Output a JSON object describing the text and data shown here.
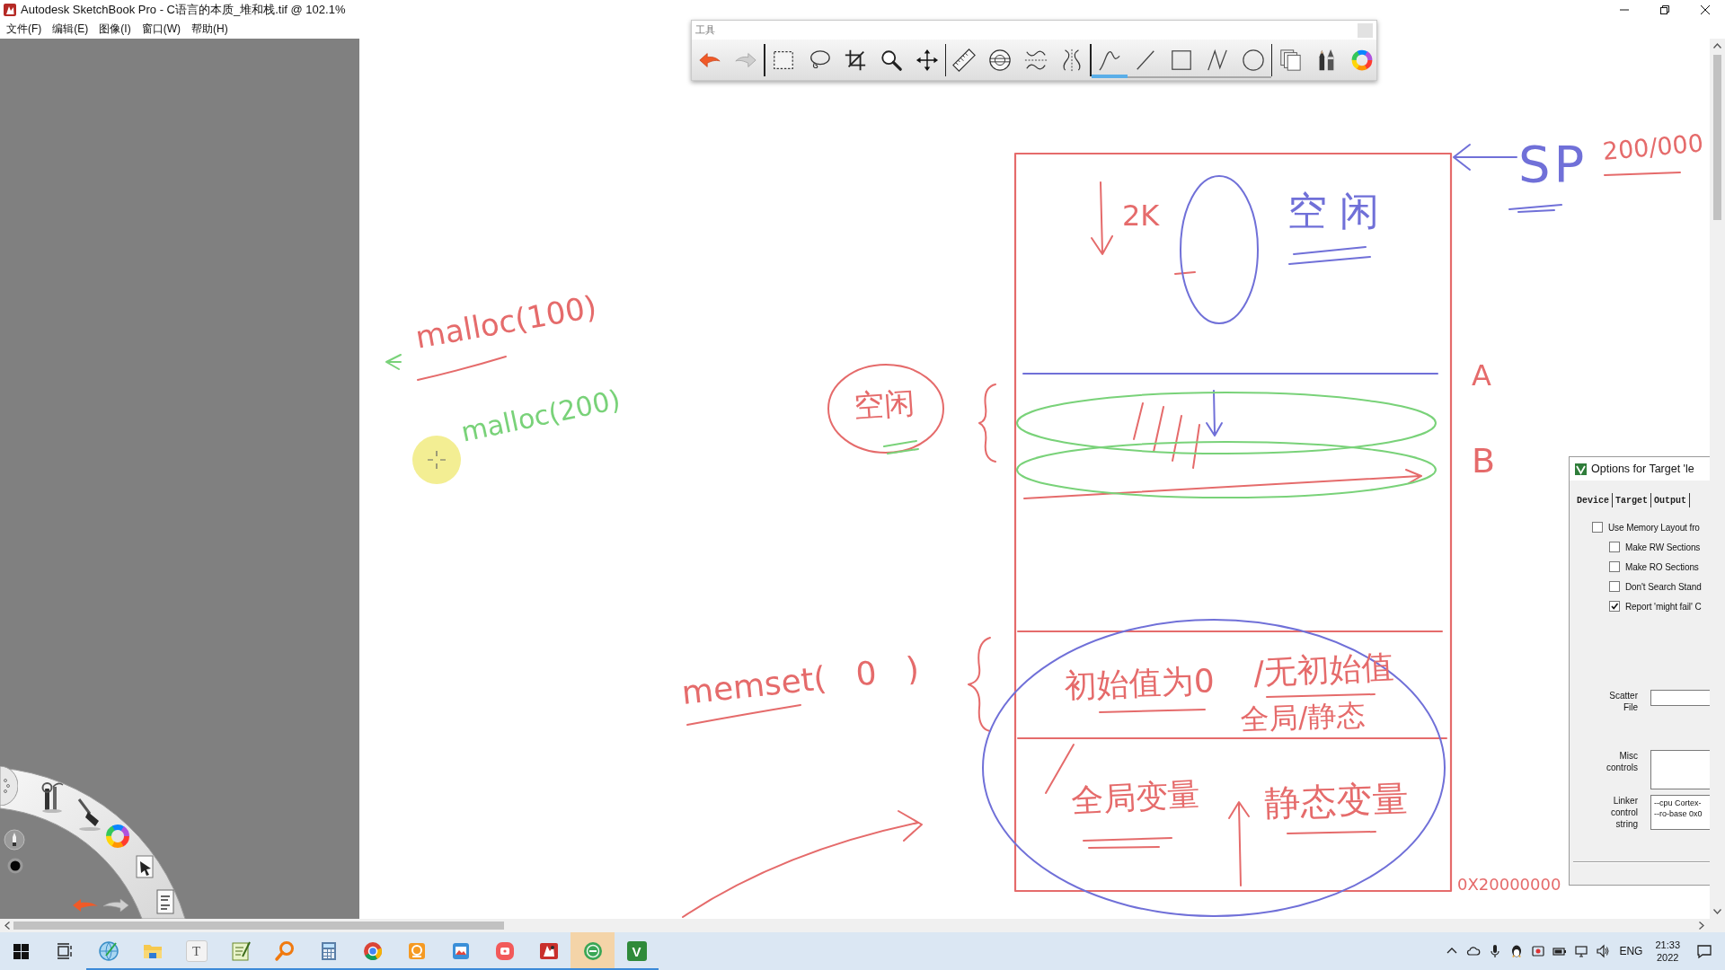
{
  "window": {
    "title": "Autodesk SketchBook Pro - C语言的本质_堆和栈.tif @ 102.1%"
  },
  "menu": [
    "文件(F)",
    "编辑(E)",
    "图像(I)",
    "窗口(W)",
    "帮助(H)"
  ],
  "tool_palette": {
    "title": "工具",
    "groups": [
      {
        "kind": "history",
        "tools": [
          {
            "kind": "undo"
          },
          {
            "kind": "redo"
          }
        ]
      },
      {
        "kind": "selection",
        "tools": [
          {
            "kind": "rect-select",
            "selected": false
          },
          {
            "kind": "lasso",
            "selected": false
          },
          {
            "kind": "crop",
            "selected": false
          },
          {
            "kind": "zoom",
            "selected": false
          },
          {
            "kind": "move",
            "selected": false
          }
        ]
      },
      {
        "kind": "guides",
        "tools": [
          {
            "kind": "ruler",
            "selected": false
          },
          {
            "kind": "ellipse-guide",
            "selected": false
          },
          {
            "kind": "symmetry-x",
            "selected": false
          },
          {
            "kind": "symmetry-y",
            "selected": false
          }
        ]
      },
      {
        "kind": "shapes",
        "tools": [
          {
            "kind": "freehand",
            "selected": true
          },
          {
            "kind": "line",
            "selected": false
          },
          {
            "kind": "rectangle",
            "selected": false
          },
          {
            "kind": "polyline",
            "selected": false
          },
          {
            "kind": "ellipse",
            "selected": false
          }
        ]
      },
      {
        "kind": "panels",
        "tools": [
          {
            "kind": "layers"
          },
          {
            "kind": "brushes"
          },
          {
            "kind": "colors"
          }
        ]
      }
    ]
  },
  "canvas": {
    "notes": [
      {
        "text": "malloc(100)",
        "color": "#e56b6b"
      },
      {
        "text": "malloc(200)",
        "color": "#79d279"
      },
      {
        "text": "2K",
        "color": "#e56b6b"
      },
      {
        "text": "空闲",
        "color": "#7070d8"
      },
      {
        "text": "空闲",
        "color": "#e56b6b"
      },
      {
        "text": "SP",
        "color": "#7070d8"
      },
      {
        "text": "200/000",
        "color": "#e56b6b"
      },
      {
        "text": "A",
        "color": "#e56b6b"
      },
      {
        "text": "B",
        "color": "#e56b6b"
      },
      {
        "text": "memset( 0 )",
        "color": "#e56b6b"
      },
      {
        "text": "初始值为0",
        "color": "#e56b6b"
      },
      {
        "text": "/无初始值",
        "color": "#e56b6b"
      },
      {
        "text": "全局/静态",
        "color": "#e56b6b"
      },
      {
        "text": "全局变量",
        "color": "#e56b6b"
      },
      {
        "text": "静态变量",
        "color": "#e56b6b"
      },
      {
        "text": "0X20000000",
        "color": "#e56b6b"
      }
    ]
  },
  "dialog": {
    "title": "Options for Target 'le",
    "tabs": [
      {
        "label": "Device",
        "selected": false
      },
      {
        "label": "Target",
        "selected": false
      },
      {
        "label": "Output",
        "selected": false
      }
    ],
    "layout_option": {
      "label": "Use Memory Layout fro",
      "checked": false
    },
    "section_options": [
      {
        "label": "Make RW Sections",
        "checked": false
      },
      {
        "label": "Make RO Sections",
        "checked": false
      },
      {
        "label": "Don't Search Stand",
        "checked": false
      },
      {
        "label": "Report 'might fail' C",
        "checked": true
      }
    ],
    "fields": [
      {
        "kind": "line",
        "label": "Scatter File"
      },
      {
        "kind": "box",
        "label": "Misc controls"
      },
      {
        "kind": "box",
        "label": "Linker control string",
        "lines": [
          "--cpu Cortex-",
          "--ro-base 0x0"
        ]
      }
    ]
  },
  "taskbar": {
    "apps": [
      {
        "kind": "globe",
        "running": true,
        "highlighted": false
      },
      {
        "kind": "folder",
        "running": true,
        "highlighted": false
      },
      {
        "kind": "text-editor",
        "glyph": "T",
        "running": true,
        "highlighted": false
      },
      {
        "kind": "notepad",
        "running": true,
        "highlighted": false
      },
      {
        "kind": "search-tool",
        "running": true,
        "highlighted": false
      },
      {
        "kind": "calculator",
        "running": true,
        "highlighted": false
      },
      {
        "kind": "tricolor",
        "running": true,
        "highlighted": false
      },
      {
        "kind": "tile-app",
        "running": true,
        "highlighted": false
      },
      {
        "kind": "picture-app",
        "running": true,
        "highlighted": false
      },
      {
        "kind": "rounded-app",
        "running": true,
        "highlighted": false
      },
      {
        "kind": "sketch-app",
        "running": true,
        "highlighted": false
      },
      {
        "kind": "round-badge",
        "running": true,
        "highlighted": true
      },
      {
        "kind": "v-tile",
        "glyph": "V",
        "running": true,
        "highlighted": false
      }
    ],
    "tray": {
      "input_language": "ENG",
      "time": "21:33",
      "date": "2022"
    }
  }
}
